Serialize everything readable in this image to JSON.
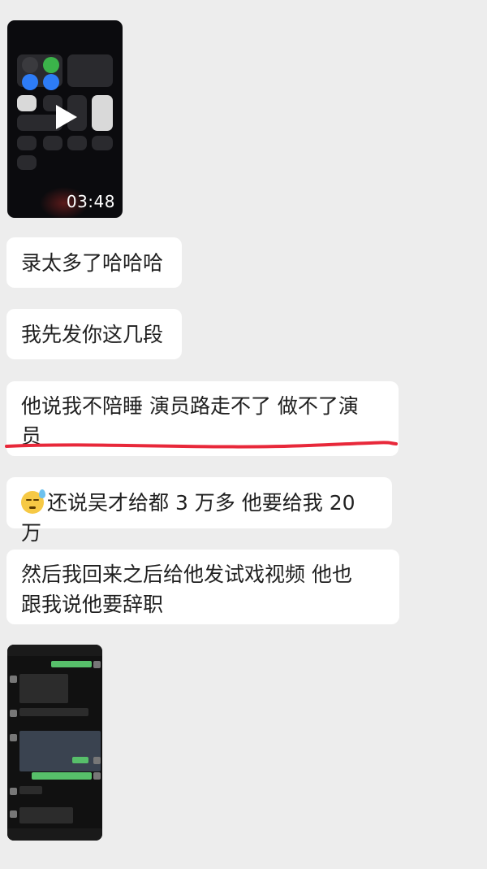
{
  "video": {
    "duration": "03:48"
  },
  "messages": [
    {
      "id": "m1",
      "text": "录太多了哈哈哈"
    },
    {
      "id": "m2",
      "text": "我先发你这几段"
    },
    {
      "id": "m3",
      "line1": "他说我不陪睡 演员路走不了 做不了演",
      "line2": "员"
    },
    {
      "id": "m4",
      "emoji": "sweat-face-emoji",
      "text": "还说吴才给都 3 万多 他要给我 20 万"
    },
    {
      "id": "m5",
      "line1": "然后我回来之后给他发试戏视频 他也",
      "line2": "跟我说他要辞职"
    }
  ],
  "colors": {
    "background": "#ededed",
    "bubble": "#ffffff",
    "text": "#1f1f1f",
    "underline": "#e8283a"
  }
}
